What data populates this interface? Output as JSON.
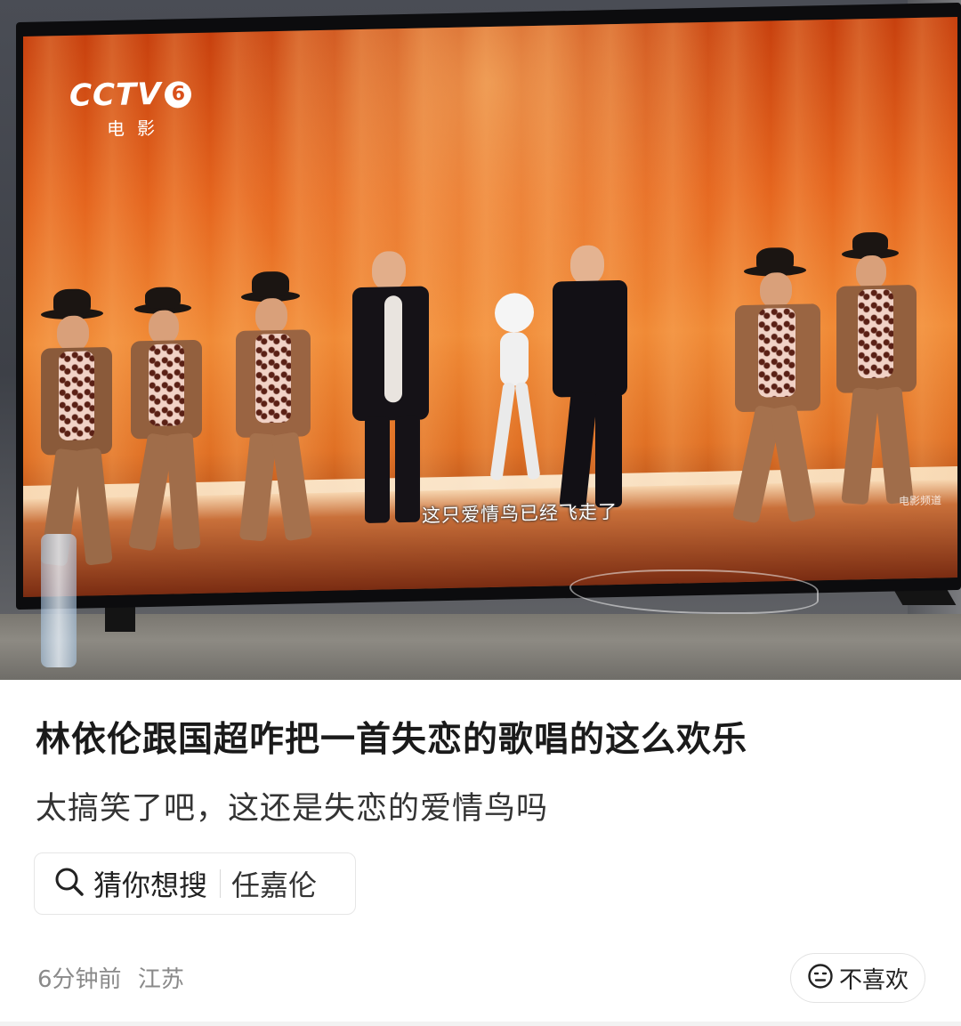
{
  "photo": {
    "tv_channel_logo": "CCTV",
    "tv_channel_number": "6",
    "tv_channel_sub": "电影",
    "tv_subtitle": "这只爱情鸟已经飞走了",
    "tv_watermark": "电影频道"
  },
  "post": {
    "title": "林依伦跟国超咋把一首失恋的歌唱的这么欢乐",
    "body": "太搞笑了吧，这还是失恋的爱情鸟吗"
  },
  "suggest": {
    "icon": "search-icon",
    "label": "猜你想搜",
    "keyword": "任嘉伦"
  },
  "meta": {
    "time": "6分钟前",
    "location": "江苏"
  },
  "dislike": {
    "icon": "sad-face-icon",
    "label": "不喜欢"
  }
}
